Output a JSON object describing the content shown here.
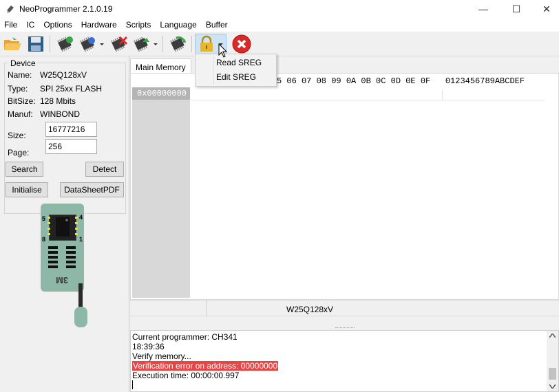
{
  "window": {
    "title": "NeoProgrammer 2.1.0.19",
    "minimize": "—",
    "maximize": "☐",
    "close": "✕"
  },
  "menu": [
    "File",
    "IC",
    "Options",
    "Hardware",
    "Scripts",
    "Language",
    "Buffer"
  ],
  "toolbar_icons": [
    "open-folder-icon",
    "save-icon",
    "read-chip-icon",
    "write-chip-icon",
    "erase-chip-icon",
    "verify-chip-icon",
    "auto-chip-icon",
    "lock-icon",
    "stop-icon"
  ],
  "device": {
    "group_label": "Device",
    "name_label": "Name:",
    "name_value": "W25Q128xV",
    "type_label": "Type:",
    "type_value": "SPI 25xx FLASH",
    "bitsize_label": "BitSize:",
    "bitsize_value": "128 Mbits",
    "manuf_label": "Manuf:",
    "manuf_value": "WINBOND",
    "size_label": "Size:",
    "size_value": "16777216",
    "page_label": "Page:",
    "page_value": "256"
  },
  "buttons": {
    "search": "Search",
    "detect": "Detect",
    "initialise": "Initialise",
    "datasheet": "DataSheetPDF"
  },
  "adapter": {
    "pin5": "5",
    "pin4": "4",
    "pin8": "8",
    "pin1": "1",
    "label": "3M"
  },
  "main": {
    "tab": "Main Memory",
    "hex_header": "5 06 07 08 09 0A 0B 0C 0D 0E 0F   0123456789ABCDEF",
    "address": "0x00000000",
    "status_chip": "W25Q128xV"
  },
  "sreg_menu": {
    "read": "Read SREG",
    "edit": "Edit SREG"
  },
  "log": [
    {
      "text": "Current programmer: CH341",
      "error": false
    },
    {
      "text": "18:39:36",
      "error": false
    },
    {
      "text": "Verify memory...",
      "error": false
    },
    {
      "text": "Verification error on address: 00000000",
      "error": true
    },
    {
      "text": "Execution time: 00:00:00.997",
      "error": false
    }
  ],
  "colors": {
    "error_bg": "#e64646",
    "stop_red": "#d92a2a",
    "chip_green": "#8db7a6"
  }
}
